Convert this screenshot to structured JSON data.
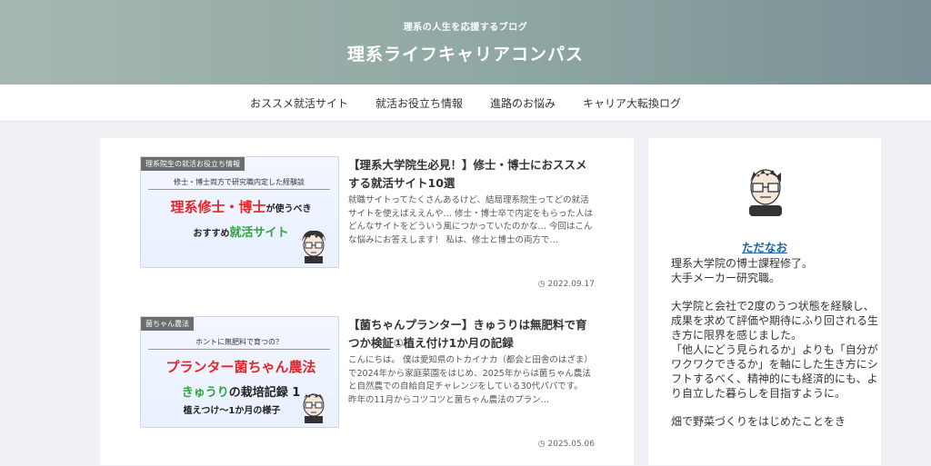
{
  "header": {
    "tagline": "理系の人生を応援するブログ",
    "title": "理系ライフキャリアコンパス",
    "gradient_colors": [
      "#a6b7b0",
      "#7a9096"
    ]
  },
  "nav": {
    "items": [
      "おススメ就活サイト",
      "就活お役立ち情報",
      "進路のお悩み",
      "キャリア大転換ログ"
    ]
  },
  "posts": [
    {
      "category": "理系院生の就活お役立ち情報",
      "thumb_lines": {
        "line1": "修士・博士両方で研究職内定した経験談",
        "line2a": "理系修士・博士",
        "line2b": "が使うべき",
        "line3a": "おすすめ",
        "line3b": "就活サイト"
      },
      "title": "【理系大学院生必見！】修士・博士におススメする就活サイト10選",
      "snippet": "就職サイトってたくさんあるけど、結局理系院生ってどの就活サイトを使えばええんや… 修士・博士卒で内定をもらった人はどんなサイトをどういう風につかっていたのかな… 今回はこんな悩みにお答えします！ 私は、修士と博士の両方で…",
      "date": "2022.09.17"
    },
    {
      "category": "菌ちゃん農法",
      "thumb_lines": {
        "line1": "ホントに無肥料で育つの？",
        "line2": "プランター菌ちゃん農法",
        "line3a": "きゅうり",
        "line3b": "の栽培記録 1",
        "line4": "植えつけ～1か月の様子"
      },
      "title": "【菌ちゃんプランター】きゅうりは無肥料で育つか検証①植え付け1か月の記録",
      "snippet": "こんにちは。 僕は愛知県のトカイナカ（都会と田舎のはざま）で2024年から家庭菜園をはじめ、2025年からは菌ちゃん農法と自然農での自給自足チャレンジをしている30代パパです。 昨年の11月からコツコツと菌ちゃん農法のプラン…",
      "date": "2025.05.06"
    }
  ],
  "profile": {
    "name": "ただなお",
    "paragraphs": [
      "理系大学院の博士課程修了。\n大手メーカー研究職。",
      "大学院と会社で2度のうつ状態を経験し、成果を求めて評価や期待にふり回される生き方に限界を感じました。\n「他人にどう見られるか」よりも「自分がワクワクできるか」を軸にした生き方にシフトするべく、精神的にも経済的にも、より自立した暮らしを目指すように。",
      "畑で野菜づくりをはじめたことをき"
    ]
  }
}
